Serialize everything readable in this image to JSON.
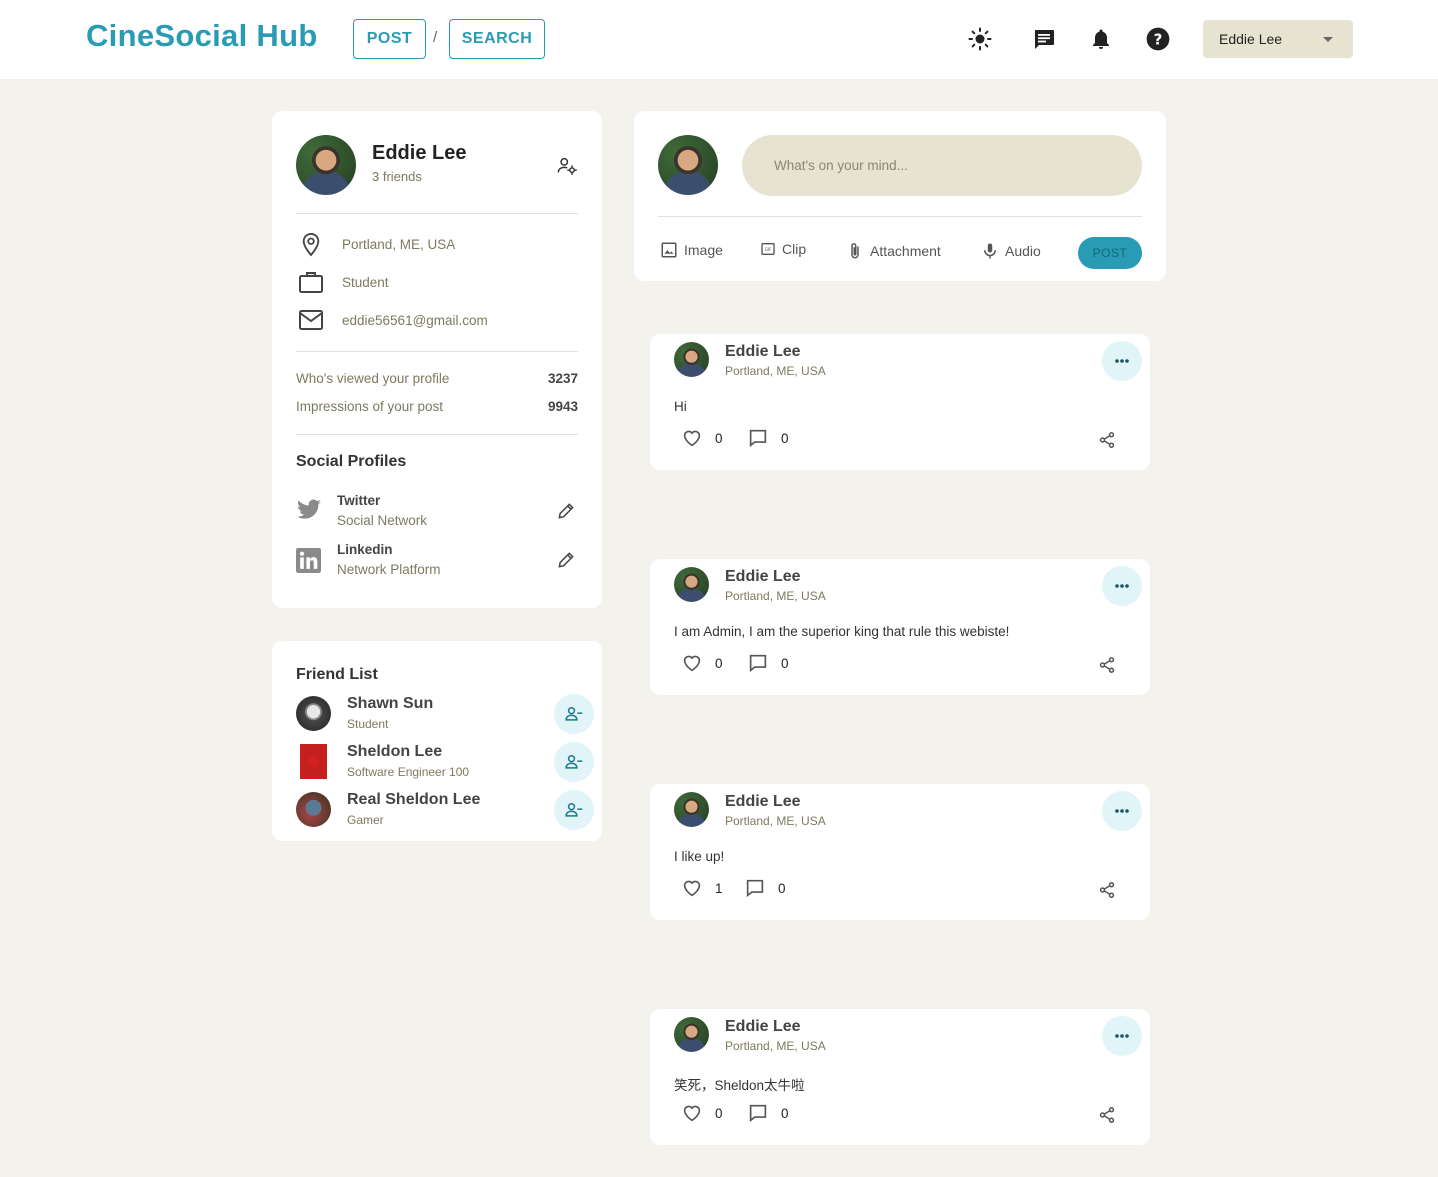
{
  "header": {
    "brand": "CineSocial Hub",
    "nav_post": "POST",
    "nav_separator": "/",
    "nav_search": "SEARCH",
    "icons": [
      "sun-icon",
      "message-icon",
      "bell-icon",
      "help-icon"
    ],
    "user_select": "Eddie Lee"
  },
  "profile": {
    "name": "Eddie Lee",
    "friends": "3 friends",
    "location": "Portland, ME, USA",
    "occupation": "Student",
    "email": "eddie56561@gmail.com",
    "stats": [
      {
        "label": "Who's viewed your profile",
        "value": "3237"
      },
      {
        "label": "Impressions of your post",
        "value": "9943"
      }
    ],
    "social_title": "Social Profiles",
    "social": [
      {
        "name": "Twitter",
        "sub": "Social Network",
        "icon": "twitter-icon"
      },
      {
        "name": "Linkedin",
        "sub": "Network Platform",
        "icon": "linkedin-icon"
      }
    ]
  },
  "friends": {
    "title": "Friend List",
    "items": [
      {
        "name": "Shawn Sun",
        "sub": "Student"
      },
      {
        "name": "Sheldon Lee",
        "sub": "Software Engineer 100"
      },
      {
        "name": "Real Sheldon Lee",
        "sub": "Gamer"
      }
    ]
  },
  "compose": {
    "placeholder": "What's on your mind...",
    "actions": {
      "image": "Image",
      "clip": "Clip",
      "attachment": "Attachment",
      "audio": "Audio"
    },
    "post_button": "POST"
  },
  "posts": [
    {
      "author": "Eddie Lee",
      "location": "Portland, ME, USA",
      "text": "Hi",
      "likes": "0",
      "comments": "0"
    },
    {
      "author": "Eddie Lee",
      "location": "Portland, ME, USA",
      "text": "I am Admin, I am the superior king that rule this webiste!",
      "likes": "0",
      "comments": "0"
    },
    {
      "author": "Eddie Lee",
      "location": "Portland, ME, USA",
      "text": "I like up!",
      "likes": "1",
      "comments": "0"
    },
    {
      "author": "Eddie Lee",
      "location": "Portland, ME, USA",
      "text": "笑死，Sheldon太牛啦",
      "likes": "0",
      "comments": "0"
    }
  ],
  "colors": {
    "accent": "#2a9bb5",
    "muted_text": "#7d7a5e",
    "input_bg": "#e6e4d0",
    "page_bg": "#f3f2ec"
  }
}
